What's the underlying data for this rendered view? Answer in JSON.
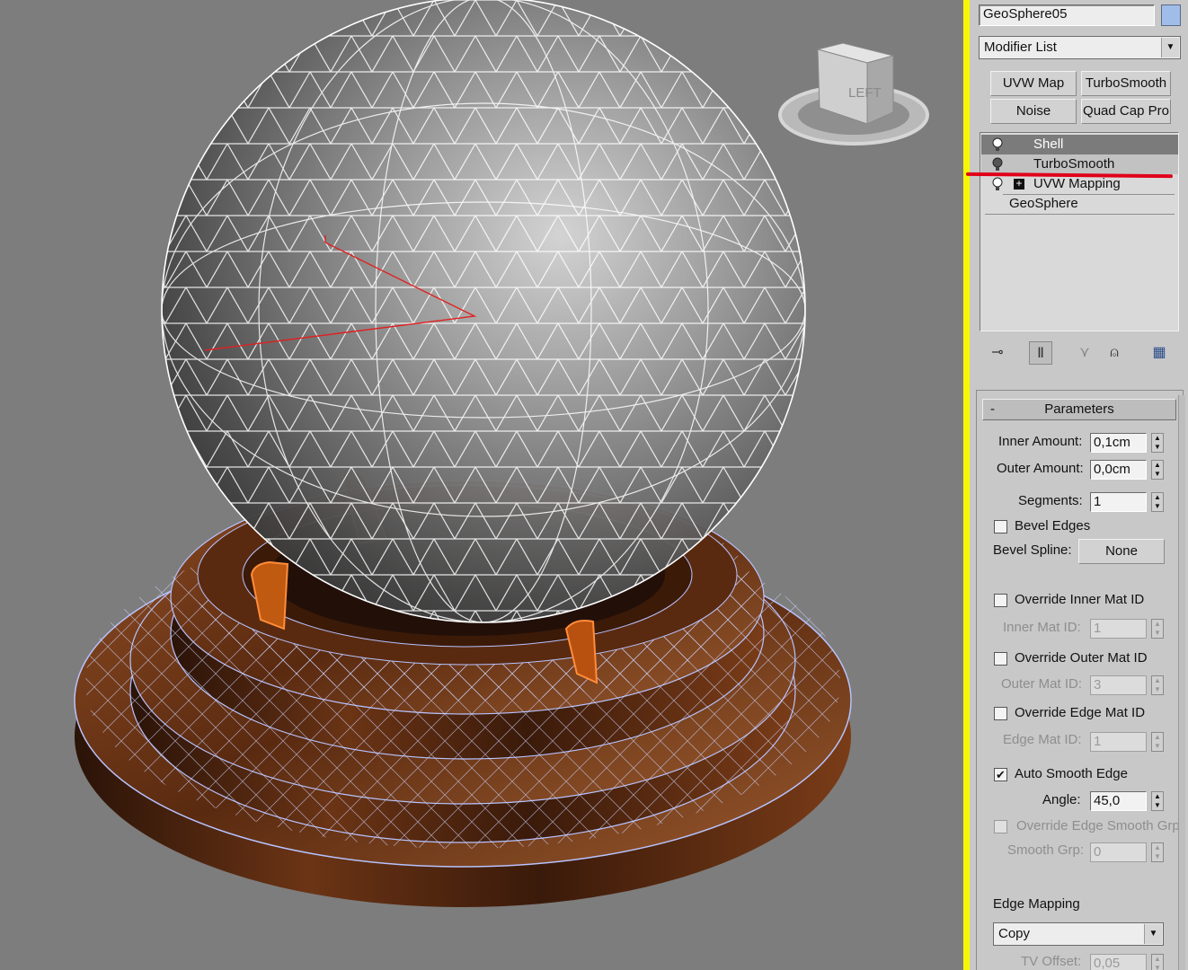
{
  "object": {
    "name": "GeoSphere05",
    "color_swatch": "#9fbde8"
  },
  "modifier_list": {
    "label": "Modifier List"
  },
  "quick_buttons": [
    "UVW Map",
    "TurboSmooth",
    "Noise",
    "Quad Cap Pro"
  ],
  "stack": [
    {
      "label": "Shell",
      "state": "selected"
    },
    {
      "label": "TurboSmooth",
      "state": "active"
    },
    {
      "label": "UVW Mapping",
      "state": "normal",
      "expandable": true
    },
    {
      "label": "GeoSphere",
      "state": "base"
    }
  ],
  "stack_toolbar_icons": [
    "pin-stack-icon",
    "show-end-result-icon",
    "make-unique-icon",
    "remove-modifier-icon",
    "configure-sets-icon"
  ],
  "viewcube": {
    "face_label": "LEFT"
  },
  "parameters": {
    "title": "Parameters",
    "collapse": "-",
    "inner_amount": {
      "label": "Inner Amount:",
      "value": "0,1cm"
    },
    "outer_amount": {
      "label": "Outer Amount:",
      "value": "0,0cm"
    },
    "segments": {
      "label": "Segments:",
      "value": "1"
    },
    "bevel_edges": {
      "label": "Bevel Edges",
      "checked": false
    },
    "bevel_spline": {
      "label": "Bevel Spline:",
      "value": "None"
    },
    "override_inner_mat": {
      "label": "Override Inner Mat ID",
      "checked": false
    },
    "inner_mat_id": {
      "label": "Inner Mat ID:",
      "value": "1"
    },
    "override_outer_mat": {
      "label": "Override Outer Mat ID",
      "checked": false
    },
    "outer_mat_id": {
      "label": "Outer Mat ID:",
      "value": "3"
    },
    "override_edge_mat": {
      "label": "Override Edge Mat ID",
      "checked": false
    },
    "edge_mat_id": {
      "label": "Edge Mat ID:",
      "value": "1"
    },
    "auto_smooth": {
      "label": "Auto Smooth Edge",
      "checked": true,
      "mark": "✔"
    },
    "angle": {
      "label": "Angle:",
      "value": "45,0"
    },
    "override_edge_smooth": {
      "label": "Override Edge Smooth Grp",
      "checked": false
    },
    "smooth_grp": {
      "label": "Smooth Grp:",
      "value": "0"
    },
    "edge_mapping": {
      "label": "Edge Mapping",
      "value": "Copy"
    },
    "tv_offset": {
      "label": "TV Offset:",
      "value": "0,05"
    }
  },
  "colors": {
    "highlight_line": "#e0001a",
    "viewport_bg": "#7d7d7d",
    "panel_bg": "#c8c8c8",
    "separator": "#f7f700"
  }
}
